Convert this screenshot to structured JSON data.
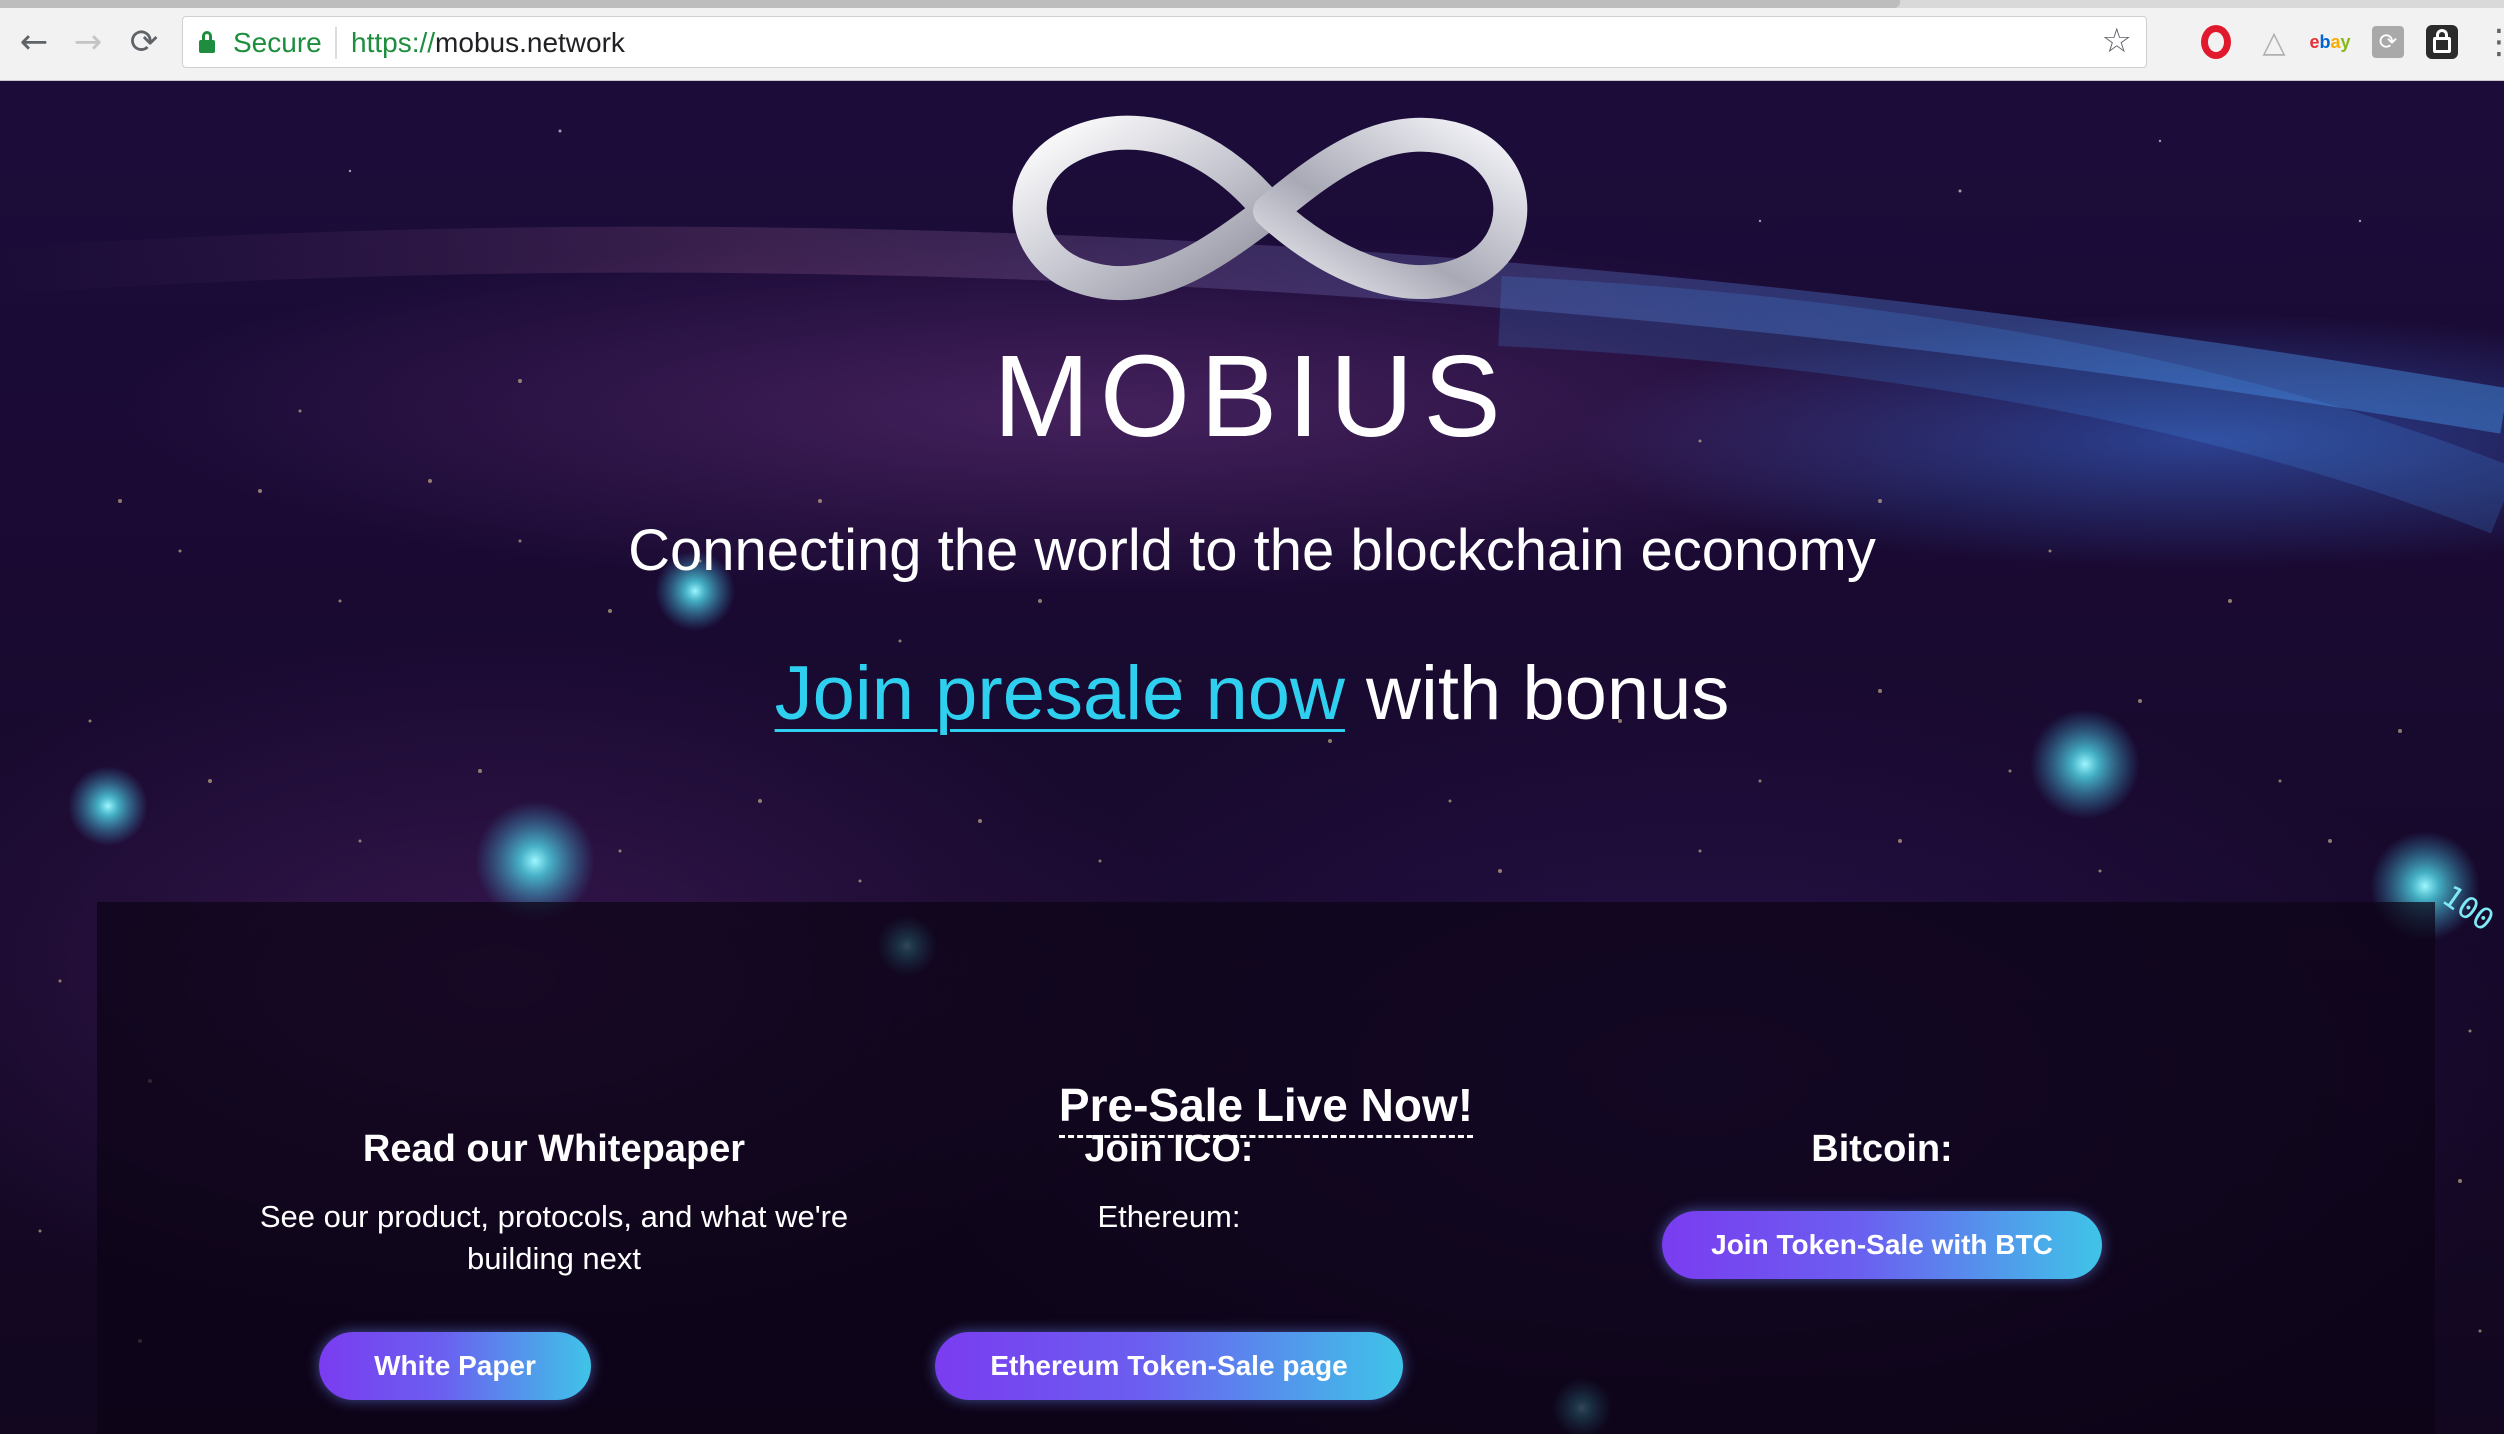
{
  "browser": {
    "nav": {
      "back_icon": "←",
      "forward_icon": "→",
      "reload_icon": "⟳"
    },
    "omnibox": {
      "secure_label": "Secure",
      "url_scheme": "https://",
      "url_host": "mobus.network",
      "star_icon": "☆"
    },
    "extensions": {
      "ghost_icon": "△",
      "ebay_letters": [
        "e",
        "b",
        "a",
        "y"
      ],
      "box_icon_glyph": "⟳",
      "menu_icon": "⋮"
    }
  },
  "hero": {
    "brand": "MOBIUS",
    "tagline": "Connecting the world to the blockchain economy",
    "presale_link": "Join presale now",
    "presale_suffix": " with bonus"
  },
  "panel": {
    "title": "Pre-Sale Live Now!",
    "columns": [
      {
        "heading": "Read our Whitepaper",
        "text": "See our product, protocols, and what we're building next",
        "button": "White Paper"
      },
      {
        "heading": "Join ICO:",
        "text": "Ethereum:",
        "button": "Ethereum Token-Sale page"
      },
      {
        "heading": "Bitcoin:",
        "text": "",
        "button": "Join Token-Sale with BTC"
      }
    ]
  },
  "decor": {
    "binary_text": "100"
  },
  "colors": {
    "accent_cyan": "#2fd0ef",
    "button_gradient_start": "#7a3cf0",
    "button_gradient_end": "#3fc4e8",
    "secure_green": "#1e8e3e"
  }
}
